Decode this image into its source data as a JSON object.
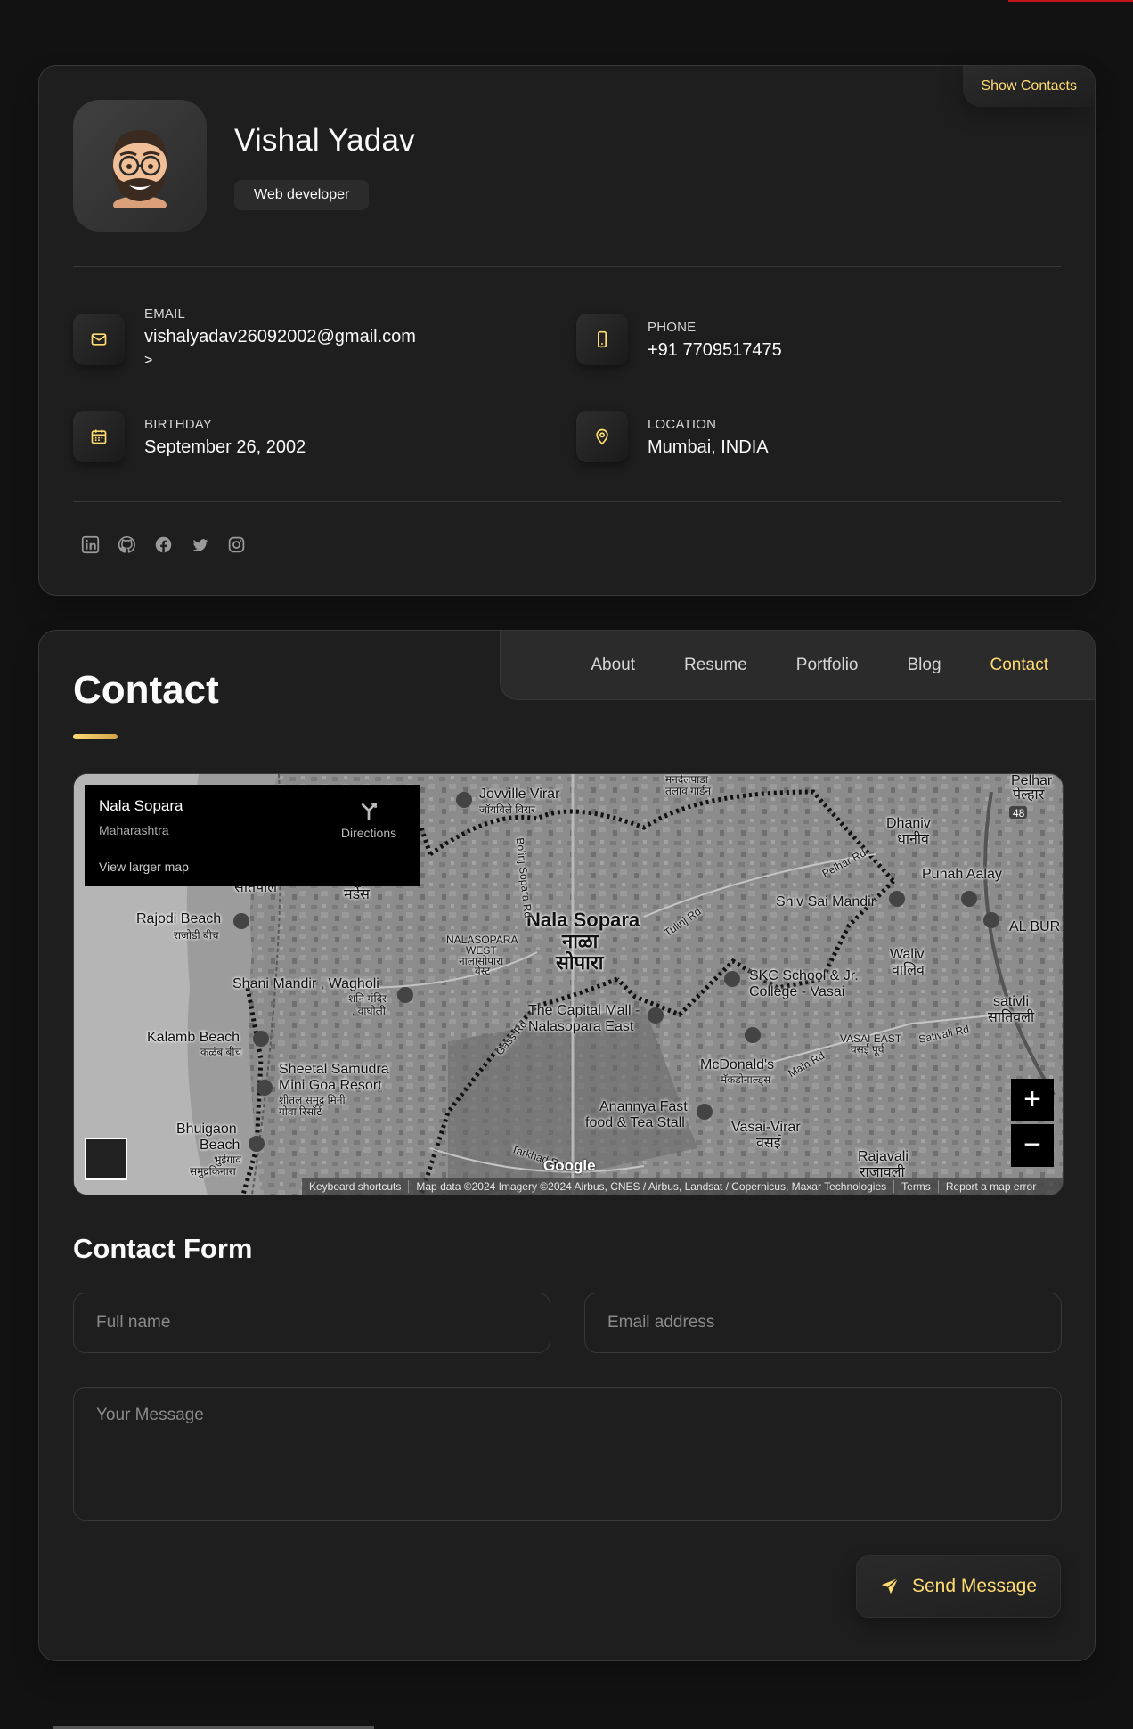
{
  "sidebar": {
    "show_contacts_label": "Show Contacts",
    "name": "Vishal Yadav",
    "title": "Web developer",
    "contacts": {
      "email": {
        "title": "Email",
        "value": "vishalyadav26092002@gmail.com",
        "extra": ">"
      },
      "phone": {
        "title": "Phone",
        "value": "+91 7709517475"
      },
      "birthday": {
        "title": "Birthday",
        "value": "September 26, 2002"
      },
      "location": {
        "title": "Location",
        "value": "Mumbai, INDIA"
      }
    },
    "social": [
      "linkedin-icon",
      "github-icon",
      "facebook-icon",
      "twitter-icon",
      "instagram-icon"
    ]
  },
  "navbar": {
    "items": [
      "About",
      "Resume",
      "Portfolio",
      "Blog",
      "Contact"
    ],
    "active": "Contact"
  },
  "contact": {
    "page_title": "Contact",
    "map": {
      "place": "Nala Sopara",
      "region": "Maharashtra",
      "directions": "Directions",
      "view_larger": "View larger map",
      "zoom_in": "+",
      "zoom_out": "−",
      "google": "Google",
      "footer": [
        "Keyboard shortcuts",
        "Map data ©2024 Imagery ©2024 Airbus, CNES / Airbus, Landsat / Copernicus, Maxar Technologies",
        "Terms",
        "Report a map error"
      ],
      "labels": {
        "nala_sopara": "Nala Sopara",
        "nala_sopara_mr1": "नाळा",
        "nala_sopara_mr2": "सोपारा",
        "jovville": "Jovville Virar",
        "jovville_mr": "जॉयविले विरार",
        "rajodi": "Rajodi Beach",
        "rajodi_mr": "राजोडी बीच",
        "nalasopara_west": "NALASOPARA",
        "nalasopara_west2": "WEST",
        "nalasopara_west_mr": "नालासोपारा",
        "nalasopara_west_mr2": "वेस्ट",
        "shani": "Shani Mandir , Wagholi",
        "shani_mr": "शनि मंदिर",
        "shani_mr2": ", वाघोली",
        "capital_mall": "The Capital Mall -",
        "capital_mall2": "Nalasopara East",
        "kalamb": "Kalamb Beach",
        "kalamb_mr": "कळंब बीच",
        "sheetal": "Sheetal Samudra",
        "sheetal2": "Mini Goa Resort",
        "sheetal_mr": "शीतल समुद्र मिनी",
        "sheetal_mr2": "गोवा रिसॉर्ट",
        "bhuigaon": "Bhuigaon",
        "bhuigaon2": "Beach",
        "bhuigaon_mr": "भुईगाव",
        "bhuigaon_mr2": "समुद्रकिनारा",
        "shiv": "Shiv Sai Mandir",
        "dhaniv": "Dhaniv",
        "dhaniv_mr": "धानीव",
        "punah": "Punah Aalay",
        "al_bur": "AL BUR",
        "waliv": "Waliv",
        "waliv_mr": "वालिव",
        "skc": "SKC School & Jr.",
        "skc2": "College - Vasai",
        "mcd": "McDonald's",
        "mcd_mr": "मॅकडोनाल्ड्स",
        "vasai_east": "VASAI EAST",
        "vasai_east_mr": "वसई पूर्व",
        "sativli": "sativli",
        "sativli_mr": "सातिवली",
        "anannya": "Anannya Fast",
        "anannya2": "food & Tea Stall",
        "vasai_virar": "Vasai-Virar",
        "vasai_virar_mr": "वसई",
        "rajavali": "Rajavali",
        "rajavali_mr": "राजावली",
        "mandalpada": "मनदेलपाडा",
        "mandalpada2": "तलाव गार्डन",
        "satpala": "सातपाल",
        "mardes": "मर्डेस",
        "pelhar": "Pelhar",
        "pelhar_mr": "पेल्हार",
        "bolinj": "Bolinj Sopara Rd",
        "tulinj": "Tulinj Rd",
        "pelhar_rd": "Pelhar Rd",
        "gass": "Gass Rd",
        "main_rd": "Main Rd",
        "sativali_rd": "Sativali Rd",
        "tarkhad": "Tarkhad Rd",
        "hw48": "48"
      }
    },
    "form": {
      "title": "Contact Form",
      "fullname_placeholder": "Full name",
      "email_placeholder": "Email address",
      "message_placeholder": "Your Message",
      "send_label": "Send Message"
    }
  },
  "colors": {
    "accent": "#ffdb70",
    "background": "#121212",
    "card": "#1e1e1f",
    "border": "#383838"
  }
}
